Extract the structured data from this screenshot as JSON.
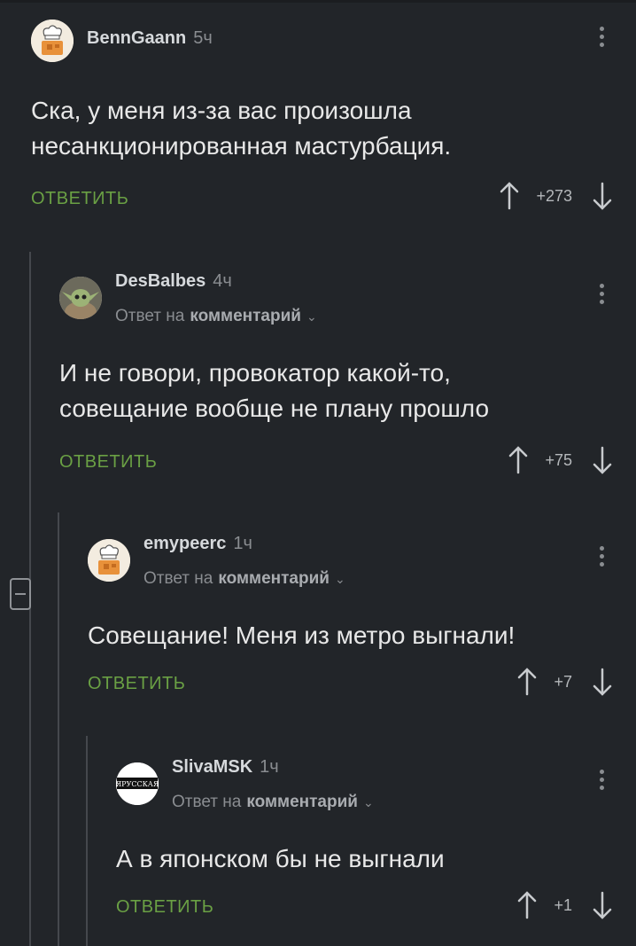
{
  "comments": [
    {
      "author": "BennGaann",
      "time": "5ч",
      "text_lines": [
        "Ска, у меня из-за вас произошла",
        "несанкционированная мастурбация."
      ],
      "reply_label": "ОТВЕТИТЬ",
      "rating": "+273",
      "avatar": "chef-avatar"
    },
    {
      "author": "DesBalbes",
      "time": "4ч",
      "reply_to_prefix": "Ответ на",
      "reply_to_link": "комментарий",
      "text_lines": [
        "И не говори, провокатор какой-то,",
        "совещание вообще не плану прошло"
      ],
      "reply_label": "ОТВЕТИТЬ",
      "rating": "+75",
      "avatar": "yoda-avatar"
    },
    {
      "author": "emypeerc",
      "time": "1ч",
      "reply_to_prefix": "Ответ на",
      "reply_to_link": "комментарий",
      "text_lines": [
        "Совещание! Меня из метро выгнали!"
      ],
      "reply_label": "ОТВЕТИТЬ",
      "rating": "+7",
      "avatar": "chef-avatar"
    },
    {
      "author": "SlivaMSK",
      "time": "1ч",
      "reply_to_prefix": "Ответ на",
      "reply_to_link": "комментарий",
      "text_lines": [
        "А в японском бы не выгнали"
      ],
      "reply_label": "ОТВЕТИТЬ",
      "rating": "+1",
      "avatar": "logo-avatar",
      "avatar_text": "ЯРУССКАЯ"
    }
  ],
  "colors": {
    "background": "#222529",
    "reply_green": "#6aa044",
    "muted": "#8a8d91"
  }
}
